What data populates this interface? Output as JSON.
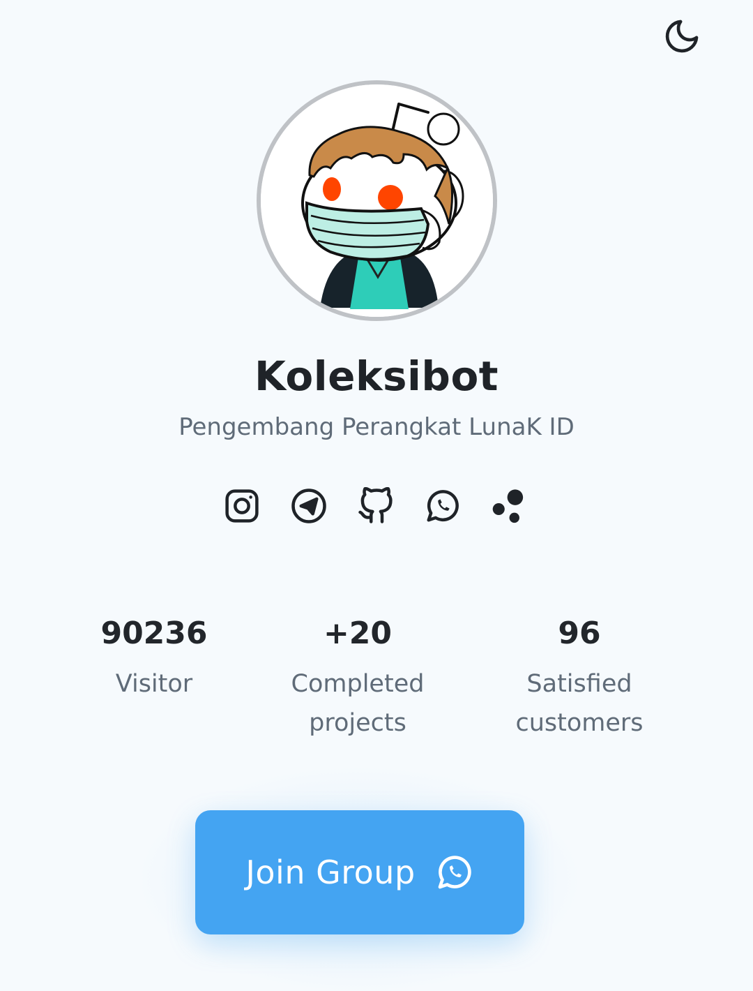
{
  "header": {
    "theme_toggle_icon": "moon-icon"
  },
  "profile": {
    "name": "Koleksibot",
    "subtitle": "Pengembang Perangkat LunaK ID",
    "avatar": "reddit-snoo-mascot-with-face-mask"
  },
  "social_links": [
    {
      "icon": "instagram-icon"
    },
    {
      "icon": "telegram-icon"
    },
    {
      "icon": "github-icon"
    },
    {
      "icon": "whatsapp-icon"
    },
    {
      "icon": "dots-cluster-icon"
    }
  ],
  "stats": [
    {
      "value": "90236",
      "label": "Visitor"
    },
    {
      "value": "+20",
      "label_line1": "Completed",
      "label_line2": "projects"
    },
    {
      "value": "96",
      "label_line1": "Satisfied",
      "label_line2": "customers"
    }
  ],
  "cta": {
    "label": "Join Group",
    "icon": "whatsapp-icon"
  },
  "colors": {
    "background": "#f6fafd",
    "accent": "#44a4f2",
    "text_primary": "#1f2328",
    "text_secondary": "#5f6b78"
  }
}
